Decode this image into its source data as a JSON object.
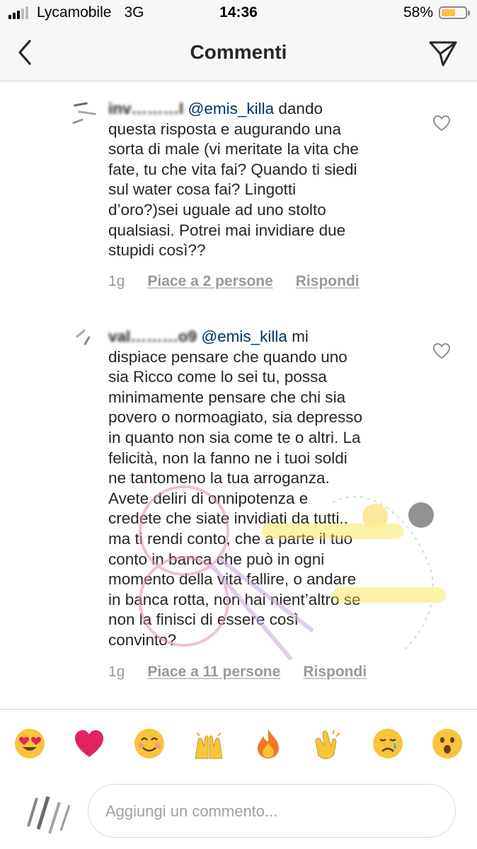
{
  "status_bar": {
    "carrier": "Lycamobile",
    "network": "3G",
    "time": "14:36",
    "battery_percent": "58%",
    "battery_level": 0.58
  },
  "header": {
    "title": "Commenti",
    "back_icon": "chevron-left-icon",
    "send_icon": "paper-plane-icon"
  },
  "comments": [
    {
      "username": "inv………l",
      "mention": "@emis_killa",
      "text_lines": [
        " dando",
        "questa risposta e augurando una",
        "sorta di male (vi meritate la vita che",
        "fate, tu che vita fai? Quando ti siedi",
        "sul water cosa fai? Lingotti",
        "d’oro?)sei uguale ad uno stolto",
        "qualsiasi. Potrei mai invidiare due",
        "stupidi così??"
      ],
      "time": "1g",
      "likes": "Piace a 2 persone",
      "reply": "Rispondi"
    },
    {
      "username": "val………o9",
      "mention": "@emis_killa",
      "text_lines": [
        " mi",
        "dispiace pensare che quando uno",
        "sia Ricco come lo sei tu, possa",
        "minimamente pensare che chi sia",
        "povero o normoagiato, sia depresso",
        "in quanto non sia come te o altri. La",
        "felicità, non la fanno ne i tuoi soldi",
        "ne tantomeno la tua arroganza.",
        "Avete deliri di onnipotenza e",
        "credete che siate invidiati da tutti..",
        "ma ti rendi conto, che a parte il tuo",
        "conto in banca che può in ogni",
        "momento della vita fallire, o andare",
        "in banca rotta, non hai nient’altro se",
        "non la finisci di essere così",
        "convinto?"
      ],
      "time": "1g",
      "likes": "Piace a 11 persone",
      "reply": "Rispondi"
    }
  ],
  "emojis": [
    {
      "name": "heart-eyes-emoji-icon",
      "color": "#f7c43c"
    },
    {
      "name": "red-heart-emoji-icon",
      "color": "#e0245e"
    },
    {
      "name": "smiling-face-emoji-icon",
      "color": "#f7c43c"
    },
    {
      "name": "raising-hands-emoji-icon",
      "color": "#f7c43c"
    },
    {
      "name": "fire-emoji-icon",
      "color": "#f4762a"
    },
    {
      "name": "clapping-hands-emoji-icon",
      "color": "#f7c43c"
    },
    {
      "name": "crying-face-emoji-icon",
      "color": "#f7c43c"
    },
    {
      "name": "surprised-face-emoji-icon",
      "color": "#f7c43c"
    }
  ],
  "input": {
    "placeholder": "Aggiungi un commento..."
  },
  "colors": {
    "text": "#262626",
    "mention": "#003569",
    "meta": "#999999",
    "header_bg": "#f7f7f7",
    "battery": "#f6c23e"
  }
}
